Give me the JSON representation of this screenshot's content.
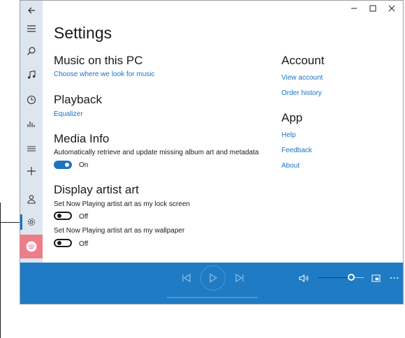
{
  "window": {
    "title_controls": [
      "minimize",
      "maximize",
      "close"
    ]
  },
  "sidebar": {
    "items": [
      {
        "name": "back",
        "icon": "back-arrow-icon"
      },
      {
        "name": "menu",
        "icon": "hamburger-icon"
      },
      {
        "name": "search",
        "icon": "search-icon"
      },
      {
        "name": "my-music",
        "icon": "music-note-icon"
      },
      {
        "name": "recent-plays",
        "icon": "clock-icon"
      },
      {
        "name": "now-playing",
        "icon": "equalizer-bars-icon"
      },
      {
        "name": "playlists",
        "icon": "list-icon"
      },
      {
        "name": "new-playlist",
        "icon": "plus-icon"
      },
      {
        "name": "account",
        "icon": "person-icon"
      },
      {
        "name": "settings",
        "icon": "gear-icon",
        "selected": true
      },
      {
        "name": "spotify",
        "icon": "spotify-icon"
      }
    ]
  },
  "settings": {
    "page_title": "Settings",
    "music_section": {
      "title": "Music on this PC",
      "link": "Choose where we look for music"
    },
    "playback_section": {
      "title": "Playback",
      "link": "Equalizer"
    },
    "media_info_section": {
      "title": "Media Info",
      "description": "Automatically retrieve and update missing album art and metadata",
      "toggle_state": "On"
    },
    "artist_art_section": {
      "title": "Display artist art",
      "lock_screen_label": "Set Now Playing artist art as my lock screen",
      "lock_screen_state": "Off",
      "wallpaper_label": "Set Now Playing artist art as my wallpaper",
      "wallpaper_state": "Off"
    },
    "account_section": {
      "title": "Account",
      "links": [
        "View account",
        "Order history"
      ]
    },
    "app_section": {
      "title": "App",
      "links": [
        "Help",
        "Feedback",
        "About"
      ]
    }
  },
  "player": {
    "volume_level": 0.73,
    "controls": [
      "previous-icon",
      "play-icon",
      "next-icon",
      "volume-icon",
      "mini-view-icon",
      "more-icon"
    ]
  },
  "colors": {
    "accent": "#1e73be",
    "player_bar": "#1f7bc4",
    "sidebar": "#dde6ee",
    "spotify_tile": "#f07c8a",
    "link": "#1a73c7"
  }
}
